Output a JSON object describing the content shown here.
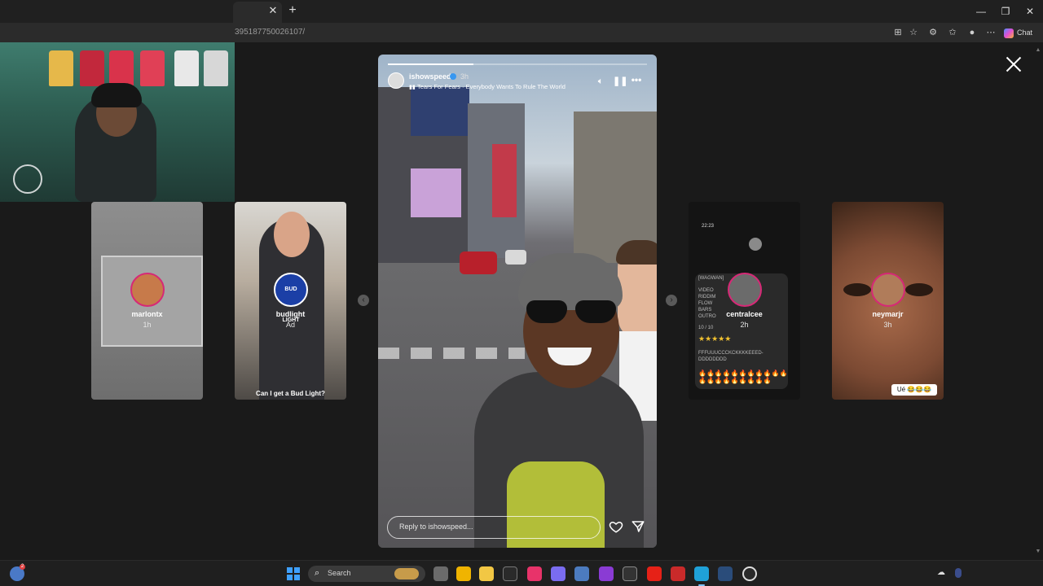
{
  "browser": {
    "url": "3951877500261​07/",
    "copilot_label": "Chat"
  },
  "viewer": {
    "main_story": {
      "username": "ishowspeed",
      "time": "3h",
      "song": "Tears For Fears · Everybody Wants To Rule The World",
      "reply_placeholder": "Reply to ishowspeed...",
      "progress": 0.33
    },
    "side_stories": [
      {
        "username": "marlontx",
        "meta": "1h"
      },
      {
        "username": "budlight",
        "meta": "Ad",
        "caption": "Can I get a Bud Light?",
        "avatar_text": "BUD LIGHT"
      },
      {
        "username": "centralcee",
        "meta": "2h"
      },
      {
        "username": "neymarjr",
        "meta": "3h",
        "tag": "Ué 😂😂😂"
      }
    ]
  },
  "centralcee_card": {
    "status_time": "22:23",
    "title": "[WAGWAN]",
    "lines": [
      "VIDEO",
      "RIDDIM",
      "FLOW",
      "BARS",
      "OUTRO"
    ],
    "score": "10 / 10",
    "stars": "★★★★★",
    "text": "FFFUUUCCCKCKKKKEEED-DDDDDDDD",
    "emojis": "🔥🔥🔥🔥🔥🔥🔥🔥🔥🔥🔥🔥🔥🔥🔥🔥🔥🔥🔥🔥"
  },
  "taskbar": {
    "search_placeholder": "Search",
    "weather_badge": "2"
  },
  "colors": {
    "background": "#1a1a1a",
    "instagram_ring": "#d62976",
    "verified": "#3897f0"
  }
}
